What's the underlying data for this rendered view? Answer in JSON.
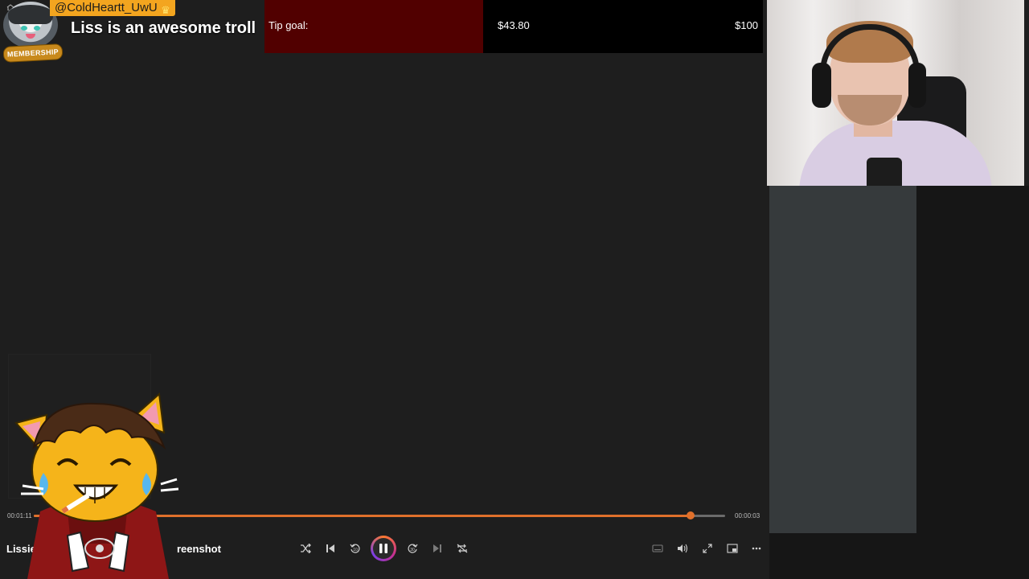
{
  "alert": {
    "username": "@ColdHeartt_UwU",
    "message": "Liss is an awesome troll",
    "badge": "MEMBERSHIP"
  },
  "tip_goal": {
    "label": "Tip goal:",
    "current": "$43.80",
    "target": "$100",
    "progress_fraction": 0.438,
    "fill_color": "#510000"
  },
  "player": {
    "elapsed": "00:01:11",
    "remaining": "00:00:03",
    "progress_fraction": 0.95,
    "title_start": "Lissie ta",
    "title_end": "reenshot",
    "accent_color": "#e0702b",
    "controls": [
      "shuffle-icon",
      "previous-icon",
      "rewind-10-icon",
      "pause-icon",
      "forward-30-icon",
      "next-icon",
      "repeat-off-icon"
    ],
    "right_controls": [
      "subtitles-icon",
      "volume-icon",
      "fullscreen-icon",
      "pip-icon",
      "more-icon"
    ]
  }
}
